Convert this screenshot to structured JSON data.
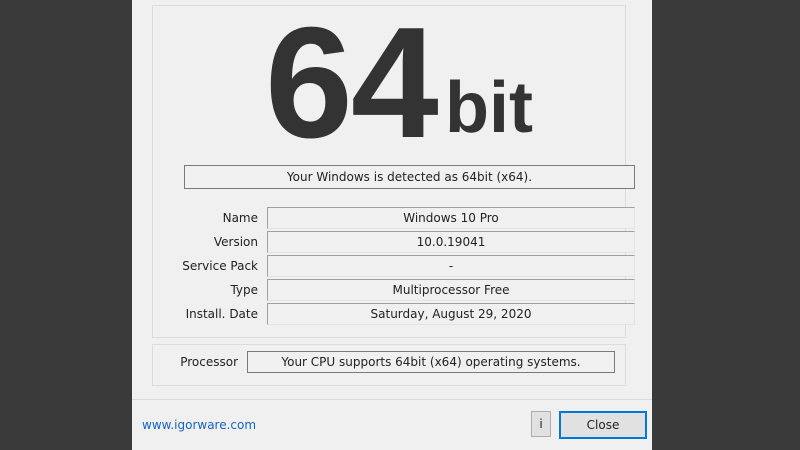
{
  "hero": {
    "number": "64",
    "suffix": "bit"
  },
  "detection_message": "Your Windows is detected as 64bit (x64).",
  "info_rows": [
    {
      "label": "Name",
      "value": "Windows 10 Pro"
    },
    {
      "label": "Version",
      "value": "10.0.19041"
    },
    {
      "label": "Service Pack",
      "value": "-"
    },
    {
      "label": "Type",
      "value": "Multiprocessor Free"
    },
    {
      "label": "Install. Date",
      "value": "Saturday, August 29, 2020"
    }
  ],
  "processor": {
    "label": "Processor",
    "value": "Your CPU supports 64bit (x64) operating systems."
  },
  "footer": {
    "website_link": "www.igorware.com",
    "info_button": "i",
    "close_button": "Close"
  },
  "colors": {
    "background": "#3a3a3a",
    "dialog": "#f0f0f0",
    "link": "#1565c0",
    "focus_border": "#0078d7"
  }
}
